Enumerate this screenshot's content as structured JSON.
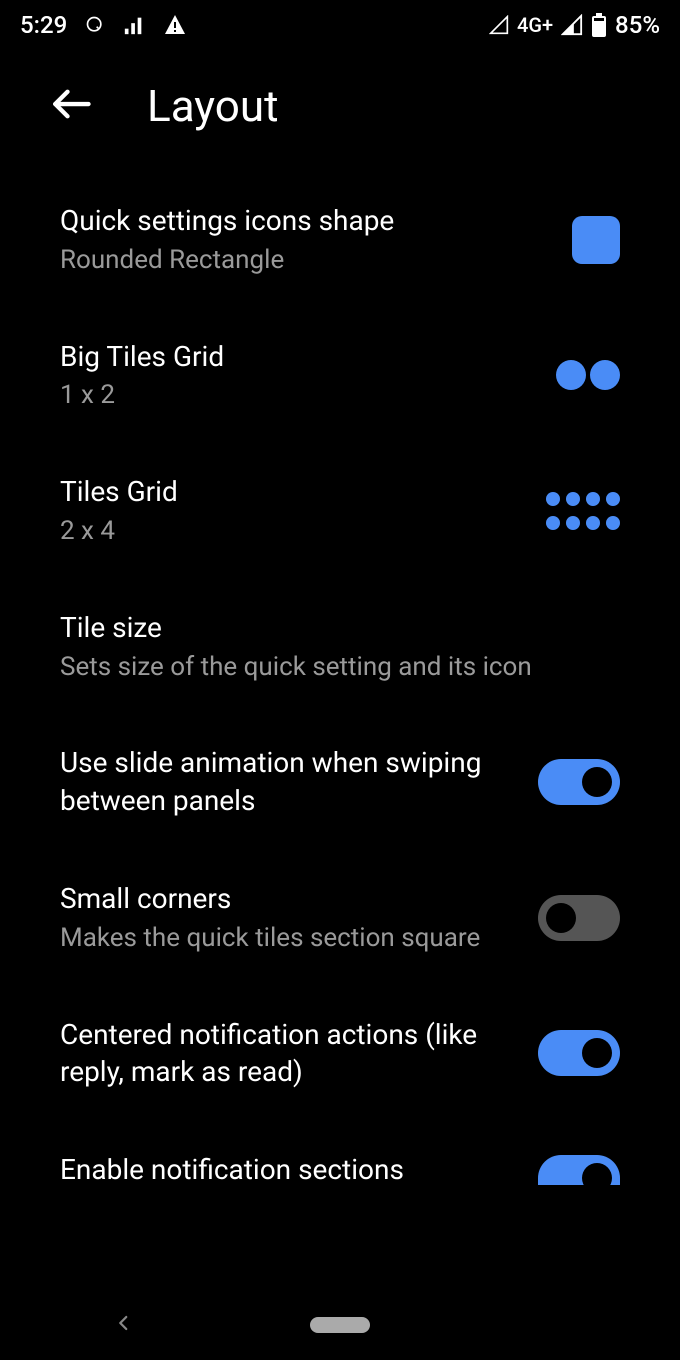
{
  "status": {
    "time": "5:29",
    "network": "4G+",
    "battery": "85%"
  },
  "header": {
    "title": "Layout"
  },
  "items": {
    "shape": {
      "title": "Quick settings icons shape",
      "subtitle": "Rounded Rectangle"
    },
    "bigTiles": {
      "title": "Big Tiles Grid",
      "subtitle": "1 x 2"
    },
    "tiles": {
      "title": "Tiles Grid",
      "subtitle": "2 x 4"
    },
    "tileSize": {
      "title": "Tile size",
      "subtitle": "Sets size of the quick setting and its icon"
    },
    "slideAnim": {
      "title": "Use slide animation when swiping between panels",
      "on": true
    },
    "smallCorners": {
      "title": "Small corners",
      "subtitle": "Makes the quick tiles section square",
      "on": false
    },
    "centeredActions": {
      "title": "Centered notification actions (like reply, mark as read)",
      "on": true
    },
    "notifSections": {
      "title": "Enable notification sections",
      "on": true
    }
  },
  "accent": "#4a8cf6"
}
